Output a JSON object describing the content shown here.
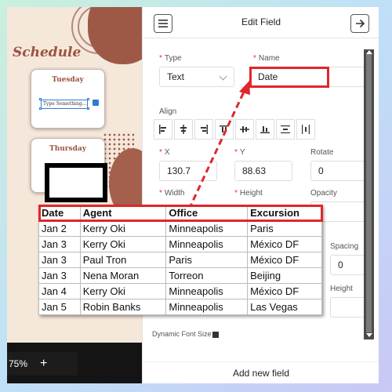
{
  "canvas": {
    "title": "Schedule",
    "cards": [
      {
        "day": "Tuesday",
        "field_text": "Type Something..."
      },
      {
        "day": "Thursday"
      }
    ],
    "zoom": "75%",
    "zoom_plus": "+"
  },
  "panel": {
    "title": "Edit Field",
    "type_label": "Type",
    "type_value": "Text",
    "name_label": "Name",
    "name_value": "Date",
    "align_label": "Align",
    "x_label": "X",
    "x_value": "130.7",
    "y_label": "Y",
    "y_value": "88.63",
    "rotate_label": "Rotate",
    "rotate_value": "0",
    "width_label": "Width",
    "height_label": "Height",
    "opacity_label": "Opacity",
    "spacing_label": "Spacing",
    "spacing_value": "0",
    "height_label_2": "Height",
    "dynamic_font_label": "Dynamic Font Size",
    "add_button": "Add new field",
    "required_mark": "*"
  },
  "table": {
    "headers": [
      "Date",
      "Agent",
      "Office",
      "Excursion"
    ],
    "rows": [
      [
        "Jan 2",
        "Kerry Oki",
        "Minneapolis",
        "Paris"
      ],
      [
        "Jan 3",
        "Kerry Oki",
        "Minneapolis",
        "México DF"
      ],
      [
        "Jan 3",
        "Paul Tron",
        "Paris",
        "México DF"
      ],
      [
        "Jan 3",
        "Nena Moran",
        "Torreon",
        "Beijing"
      ],
      [
        "Jan 4",
        "Kerry Oki",
        "Minneapolis",
        "México DF"
      ],
      [
        "Jan 5",
        "Robin Banks",
        "Minneapolis",
        "Las Vegas"
      ]
    ]
  },
  "colors": {
    "highlight": "#e0262b",
    "brand_brown": "#9a5440"
  },
  "icons": [
    "hamburger-menu-icon",
    "arrow-right-icon",
    "chevron-down-icon",
    "align-icons"
  ]
}
